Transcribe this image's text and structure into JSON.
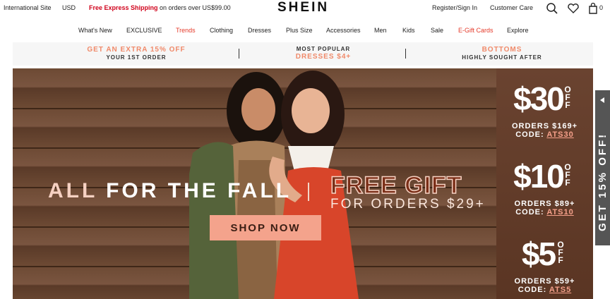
{
  "topbar": {
    "site": "International Site",
    "currency": "USD",
    "shipping_bold": "Free Express Shipping",
    "shipping_rest": " on orders over US$99.00",
    "logo": "SHEIN",
    "register": "Register/Sign In",
    "customer_care": "Customer Care",
    "cart_count": "0"
  },
  "nav": {
    "items": [
      "What's New",
      "EXCLUSIVE",
      "Trends",
      "Clothing",
      "Dresses",
      "Plus Size",
      "Accessories",
      "Men",
      "Kids",
      "Sale",
      "E-Gift Cards",
      "Explore"
    ]
  },
  "promo": {
    "left_l1": "GET AN EXTRA 15% OFF",
    "left_l2": "YOUR 1ST ORDER",
    "mid_l1": "MOST POPULAR",
    "mid_l2": "DRESSES $4+",
    "right_l1": "BOTTOMS",
    "right_l2": "HIGHLY SOUGHT AFTER"
  },
  "hero": {
    "headline_a": "ALL ",
    "headline_b": "FOR THE FALL",
    "gift": "FREE GIFT",
    "for_orders": "FOR ORDERS $29+",
    "cta": "SHOP NOW"
  },
  "offers": [
    {
      "amount": "$30",
      "off": "OFF",
      "orders": "ORDERS $169+",
      "code_label": "CODE: ",
      "code": "ATS30"
    },
    {
      "amount": "$10",
      "off": "OFF",
      "orders": "ORDERS $89+",
      "code_label": "CODE: ",
      "code": "ATS10"
    },
    {
      "amount": "$5",
      "off": "OFF",
      "orders": "ORDERS $59+",
      "code_label": "CODE: ",
      "code": "ATS5"
    }
  ],
  "sidetab": {
    "label": "GET 15% OFF!"
  },
  "colors": {
    "accent_red": "#d0021b",
    "promo_salmon": "#f08a6a",
    "cta_bg": "#f4a38c"
  }
}
